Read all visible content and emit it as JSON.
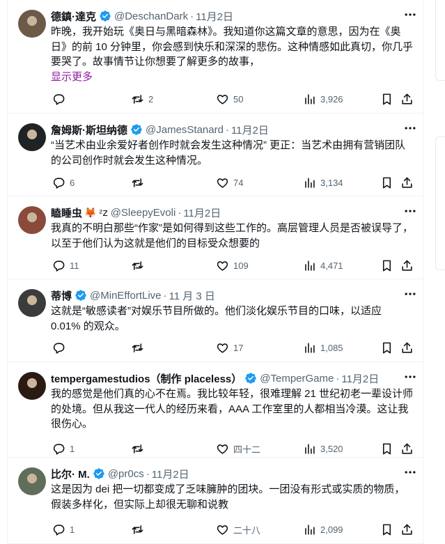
{
  "tweets": [
    {
      "name": "德鎮·達克",
      "handle": "@DeschanDark",
      "date": "11月2日",
      "text": "昨晚，我开始玩《奥日与黑暗森林》。我知道你这篇文章的意思，因为在《奥日》的前 10 分钟里，你会感到快乐和深深的悲伤。这种情感如此真切，你几乎要哭了。故事情节让你想要了解更多的故事，",
      "show_more": "显示更多",
      "replies": "",
      "retweets": "2",
      "likes": "50",
      "views": "3,926",
      "avatar_color": "#6b5a48"
    },
    {
      "name": "詹姆斯·斯坦纳德",
      "handle": "@JamesStanard",
      "date": "11月2日",
      "text": "“当艺术由业余爱好者创作时就会发生这种情况” 更正：当艺术由拥有营销团队的公司创作时就会发生这种情况。",
      "replies": "6",
      "retweets": "",
      "likes": "74",
      "views": "3,134",
      "avatar_color": "#1f2326"
    },
    {
      "name": "瞌睡虫",
      "name_emoji": "🦊 ᶻ𝗓",
      "handle": "@SleepyEvoli",
      "date": "11月2日",
      "text": "我真的不明白那些“作家”是如何得到这些工作的。高层管理人员是否被误导了，以至于他们认为这就是他们的目标受众想要的",
      "replies": "11",
      "retweets": "",
      "likes": "109",
      "views": "4,471",
      "avatar_color": "#8a4a3a"
    },
    {
      "name": "蒂博",
      "handle": "@MinEffortLive",
      "date": "11 月 3 日",
      "text": "这就是“敏感读者”对娱乐节目所做的。他们淡化娱乐节目的口味，以适应 0.01% 的观众。",
      "replies": "",
      "retweets": "",
      "likes": "17",
      "views": "1,085",
      "avatar_color": "#3b3b3b"
    },
    {
      "name": "tempergamestudios（制作 placeless）",
      "handle": "@TemperGame",
      "date": "11月2日",
      "text": "我的感觉是他们真的心不在焉。我比较年轻，很难理解 21 世纪初老一辈设计师的处境。但从我这一代人的经历来看，AAA 工作室里的人都相当冷漠。这让我很伤心。",
      "replies": "1",
      "retweets": "",
      "likes": "四十二",
      "views": "3,520",
      "avatar_color": "#2a1a12"
    },
    {
      "name": "比尔· M.",
      "handle": "@pr0cs",
      "date": "11月2日",
      "text": "这是因为 dei 把一切都变成了乏味臃肿的团块。一团没有形式或实质的物质，假装多样化，但实际上却很无聊和说教",
      "replies": "1",
      "retweets": "",
      "likes": "二十八",
      "views": "2,099",
      "avatar_color": "#5f6d5a"
    }
  ],
  "colors": {
    "text": "#0f1419",
    "secondary": "#536471",
    "verified": "#1d9bf0",
    "show_more": "#8e1b9e",
    "divider": "#eff3f4"
  },
  "icons": [
    "verified-badge-icon",
    "more-icon",
    "reply-icon",
    "retweet-icon",
    "like-icon",
    "views-icon",
    "bookmark-icon",
    "share-icon"
  ]
}
